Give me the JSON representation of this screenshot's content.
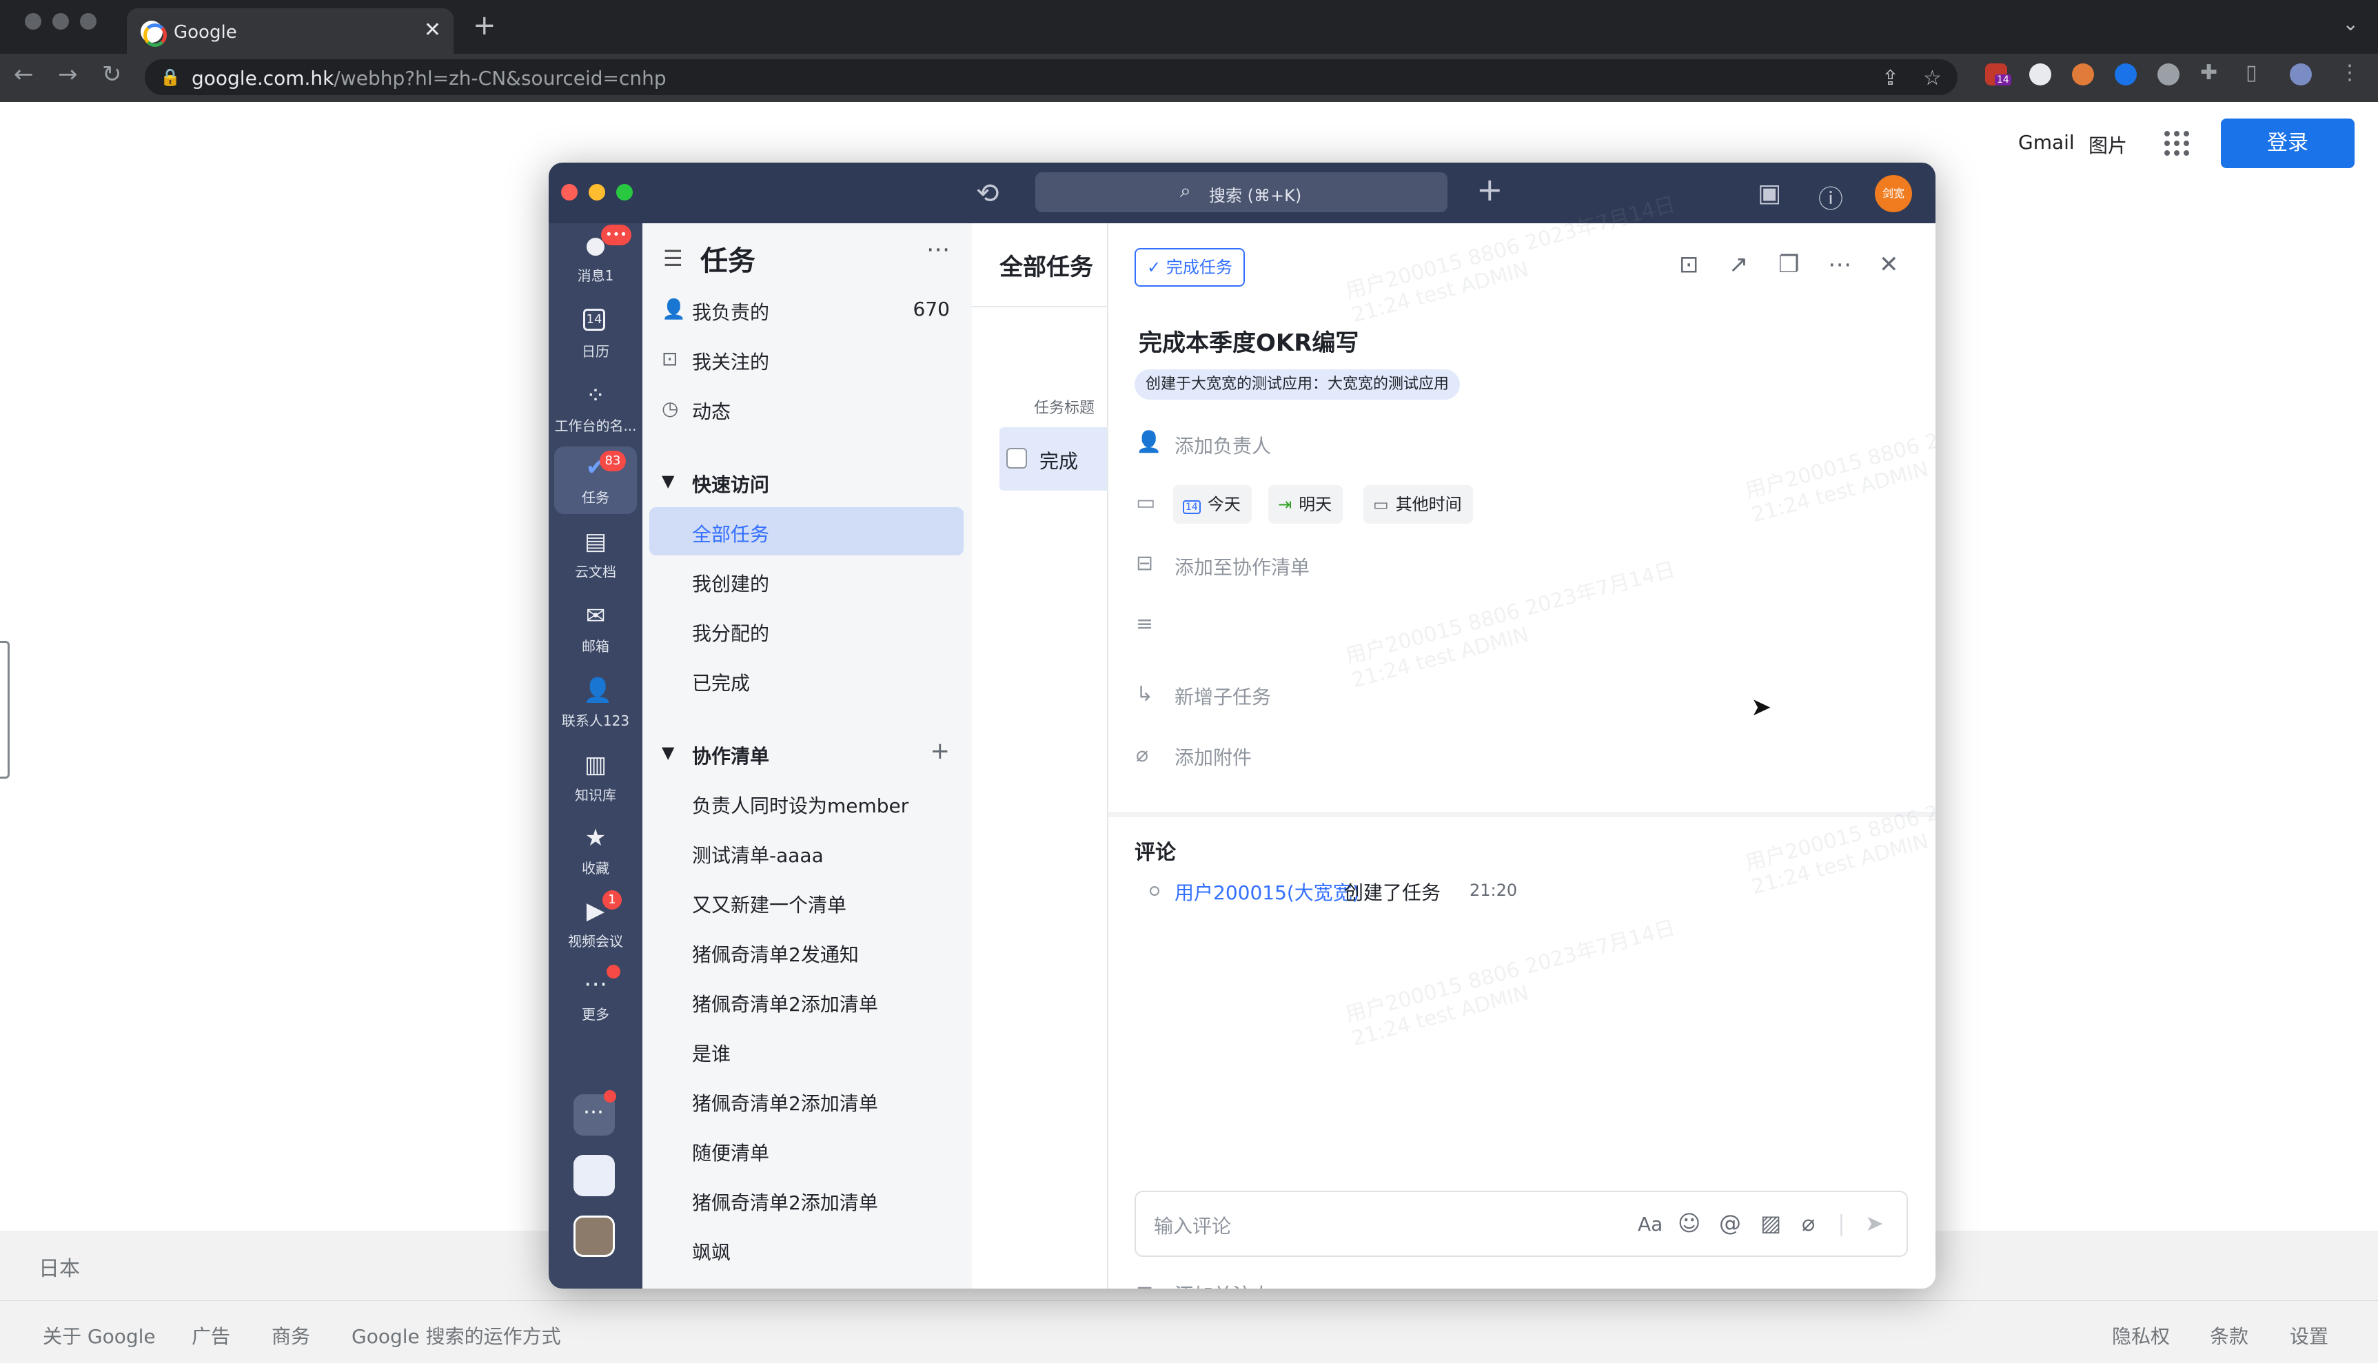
{
  "browser": {
    "tab_title": "Google",
    "tab_close": "✕",
    "new_tab": "+",
    "tab_menu": "⌄",
    "url_host": "google.com.hk",
    "url_path": "/webhp?hl=zh-CN&sourceid=cnhp",
    "ext_badge": "14"
  },
  "google": {
    "gmail": "Gmail",
    "images": "图片",
    "login": "登录",
    "country": "日本",
    "footer_left": [
      "关于 Google",
      "广告",
      "商务",
      "Google 搜索的运作方式"
    ],
    "footer_right": [
      "隐私权",
      "条款",
      "设置"
    ]
  },
  "app": {
    "search_placeholder": "搜索 (⌘+K)",
    "avatar_text": "剑宽",
    "rail": [
      {
        "label": "消息1",
        "badge": "•••"
      },
      {
        "label": "日历",
        "icon_text": "14"
      },
      {
        "label": "工作台的名..."
      },
      {
        "label": "任务",
        "badge": "83"
      },
      {
        "label": "云文档"
      },
      {
        "label": "邮箱"
      },
      {
        "label": "联系人123"
      },
      {
        "label": "知识库"
      },
      {
        "label": "收藏"
      },
      {
        "label": "视频会议",
        "badge": "1"
      },
      {
        "label": "更多"
      }
    ],
    "tasknav": {
      "title": "任务",
      "items": [
        {
          "label": "我负责的",
          "count": "670"
        },
        {
          "label": "我关注的"
        },
        {
          "label": "动态"
        }
      ],
      "quick_title": "快速访问",
      "quick_items": [
        "全部任务",
        "我创建的",
        "我分配的",
        "已完成"
      ],
      "collab_title": "协作清单",
      "collab_items": [
        "负责人同时设为member",
        "测试清单-aaaa",
        "又又新建一个清单",
        "猪佩奇清单2发通知",
        "猪佩奇清单2添加清单",
        "是谁",
        "猪佩奇清单2添加清单",
        "随便清单",
        "猪佩奇清单2添加清单",
        "飒飒"
      ]
    },
    "list": {
      "title": "全部任务",
      "column_header": "任务标题",
      "row_text": "完成"
    },
    "detail": {
      "done_button": "✓ 完成任务",
      "title": "完成本季度OKR编写",
      "origin": "创建于大宽宽的测试应用：大宽宽的测试应用",
      "add_owner": "添加负责人",
      "chip_today_icon": "14",
      "chip_today": "今天",
      "chip_tomorrow": "明天",
      "chip_other": "其他时间",
      "add_list": "添加至协作清单",
      "add_subtask": "新增子任务",
      "add_attachment": "添加附件",
      "comments_title": "评论",
      "comment_user": "用户200015(大宽宽)",
      "comment_action": "创建了任务",
      "comment_time": "21:20",
      "comment_placeholder": "输入评论",
      "font_btn": "Aa",
      "add_follower": "添加关注人"
    },
    "watermark_line1": "用户200015 8806 2023年7月14日",
    "watermark_line2": "21:24 test ADMIN"
  }
}
